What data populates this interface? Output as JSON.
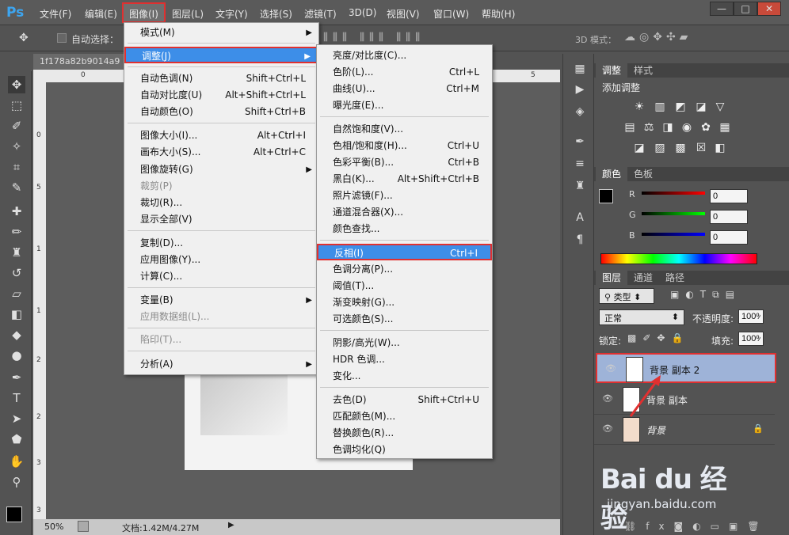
{
  "app": {
    "logo": "Ps",
    "doc_tab": "1f178a82b9014a9"
  },
  "menubar": {
    "items": [
      "文件(F)",
      "编辑(E)",
      "图像(I)",
      "图层(L)",
      "文字(Y)",
      "选择(S)",
      "滤镜(T)",
      "3D(D)",
      "视图(V)",
      "窗口(W)",
      "帮助(H)"
    ],
    "window_buttons": [
      "—",
      "□",
      "✕"
    ]
  },
  "options": {
    "auto_select": "自动选择：",
    "mode_3d": "3D 模式："
  },
  "image_menu": {
    "items": [
      {
        "label": "模式(M)",
        "shortcut": "",
        "submenu": true
      },
      {
        "label": "调整(J)",
        "shortcut": "",
        "submenu": true
      },
      {
        "label": "自动色调(N)",
        "shortcut": "Shift+Ctrl+L"
      },
      {
        "label": "自动对比度(U)",
        "shortcut": "Alt+Shift+Ctrl+L"
      },
      {
        "label": "自动颜色(O)",
        "shortcut": "Shift+Ctrl+B"
      },
      {
        "label": "图像大小(I)...",
        "shortcut": "Alt+Ctrl+I"
      },
      {
        "label": "画布大小(S)...",
        "shortcut": "Alt+Ctrl+C"
      },
      {
        "label": "图像旋转(G)",
        "shortcut": "",
        "submenu": true
      },
      {
        "label": "裁剪(P)",
        "shortcut": "",
        "disabled": true
      },
      {
        "label": "裁切(R)...",
        "shortcut": ""
      },
      {
        "label": "显示全部(V)",
        "shortcut": ""
      },
      {
        "label": "复制(D)...",
        "shortcut": ""
      },
      {
        "label": "应用图像(Y)...",
        "shortcut": ""
      },
      {
        "label": "计算(C)...",
        "shortcut": ""
      },
      {
        "label": "变量(B)",
        "shortcut": "",
        "submenu": true
      },
      {
        "label": "应用数据组(L)...",
        "shortcut": "",
        "disabled": true
      },
      {
        "label": "陷印(T)...",
        "shortcut": "",
        "disabled": true
      },
      {
        "label": "分析(A)",
        "shortcut": "",
        "submenu": true
      }
    ]
  },
  "adjust_menu": {
    "items": [
      {
        "label": "亮度/对比度(C)...",
        "shortcut": ""
      },
      {
        "label": "色阶(L)...",
        "shortcut": "Ctrl+L"
      },
      {
        "label": "曲线(U)...",
        "shortcut": "Ctrl+M"
      },
      {
        "label": "曝光度(E)...",
        "shortcut": ""
      },
      {
        "label": "自然饱和度(V)...",
        "shortcut": ""
      },
      {
        "label": "色相/饱和度(H)...",
        "shortcut": "Ctrl+U"
      },
      {
        "label": "色彩平衡(B)...",
        "shortcut": "Ctrl+B"
      },
      {
        "label": "黑白(K)...",
        "shortcut": "Alt+Shift+Ctrl+B"
      },
      {
        "label": "照片滤镜(F)...",
        "shortcut": ""
      },
      {
        "label": "通道混合器(X)...",
        "shortcut": ""
      },
      {
        "label": "颜色查找...",
        "shortcut": ""
      },
      {
        "label": "反相(I)",
        "shortcut": "Ctrl+I"
      },
      {
        "label": "色调分离(P)...",
        "shortcut": ""
      },
      {
        "label": "阈值(T)...",
        "shortcut": ""
      },
      {
        "label": "渐变映射(G)...",
        "shortcut": ""
      },
      {
        "label": "可选颜色(S)...",
        "shortcut": ""
      },
      {
        "label": "阴影/高光(W)...",
        "shortcut": ""
      },
      {
        "label": "HDR 色调...",
        "shortcut": ""
      },
      {
        "label": "变化...",
        "shortcut": ""
      },
      {
        "label": "去色(D)",
        "shortcut": "Shift+Ctrl+U"
      },
      {
        "label": "匹配颜色(M)...",
        "shortcut": ""
      },
      {
        "label": "替换颜色(R)...",
        "shortcut": ""
      },
      {
        "label": "色调均化(Q)",
        "shortcut": ""
      }
    ]
  },
  "rulers": {
    "top": [
      "0",
      "5"
    ],
    "left": [
      "0",
      "5",
      "1",
      "1",
      "2",
      "2",
      "3",
      "3"
    ]
  },
  "status": {
    "zoom": "50%",
    "doc": "文档:1.42M/4.27M"
  },
  "adjust_panel": {
    "tabs": [
      "调整",
      "样式"
    ],
    "title": "添加调整"
  },
  "color_panel": {
    "tabs": [
      "颜色",
      "色板"
    ],
    "r_label": "R",
    "g_label": "G",
    "b_label": "B",
    "r": "0",
    "g": "0",
    "b": "0"
  },
  "layers_panel": {
    "tabs": [
      "图层",
      "通道",
      "路径"
    ],
    "filter": "类型",
    "blend": "正常",
    "opacity_label": "不透明度:",
    "opacity": "100%",
    "lock_label": "锁定:",
    "fill_label": "填充:",
    "fill": "100%",
    "layers": [
      "背景 副本 2",
      "背景 副本",
      "背景"
    ]
  },
  "watermark": {
    "brand": "Bai du 经验",
    "url": "jingyan.baidu.com"
  },
  "colors": {
    "accent": "#3d8ee8",
    "highlight_border": "#e03030",
    "selected_layer": "#9eb3d8"
  }
}
